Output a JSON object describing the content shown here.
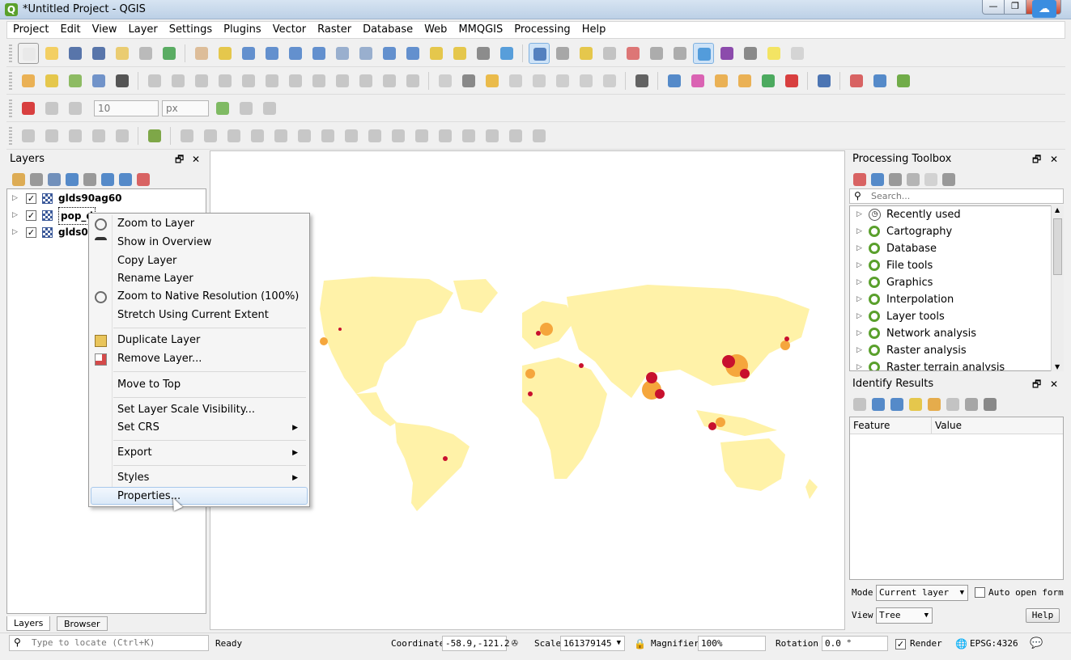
{
  "window": {
    "title": "*Untitled Project - QGIS",
    "app_icon": "qgis-logo-icon",
    "min": "—",
    "max": "❐",
    "close": "✕"
  },
  "menubar": [
    "Project",
    "Edit",
    "View",
    "Layer",
    "Settings",
    "Plugins",
    "Vector",
    "Raster",
    "Database",
    "Web",
    "MMQGIS",
    "Processing",
    "Help"
  ],
  "digitizing": {
    "snap_tolerance": "10",
    "snap_unit": "px"
  },
  "layers_panel": {
    "title": "Layers",
    "float_icon": "🗗",
    "close_icon": "✕",
    "layers": [
      {
        "name": "glds90ag60",
        "checked": "✓",
        "expand": "▷"
      },
      {
        "name": "pop_d",
        "checked": "✓",
        "expand": "▷"
      },
      {
        "name": "glds00",
        "checked": "✓",
        "expand": "▷"
      }
    ],
    "tabs": [
      "Layers",
      "Browser"
    ]
  },
  "context_menu": {
    "items": [
      {
        "label": "Zoom to Layer",
        "icon": "zoom-layer-icon"
      },
      {
        "label": "Show in Overview",
        "icon": "overview-icon"
      },
      {
        "label": "Copy Layer"
      },
      {
        "label": "Rename Layer"
      },
      {
        "label": "Zoom to Native Resolution (100%)",
        "icon": "native-resolution-icon"
      },
      {
        "label": "Stretch Using Current Extent"
      },
      {
        "label": "Duplicate Layer",
        "icon": "duplicate-icon"
      },
      {
        "label": "Remove Layer...",
        "icon": "remove-layer-icon"
      },
      {
        "label": "Move to Top"
      },
      {
        "label": "Set Layer Scale Visibility..."
      },
      {
        "label": "Set CRS",
        "submenu": "▶"
      },
      {
        "label": "Export",
        "submenu": "▶"
      },
      {
        "label": "Styles",
        "submenu": "▶"
      },
      {
        "label": "Properties..."
      }
    ]
  },
  "processing": {
    "title": "Processing Toolbox",
    "float_icon": "🗗",
    "close_icon": "✕",
    "search_placeholder": "Search...",
    "items": [
      "Recently used",
      "Cartography",
      "Database",
      "File tools",
      "Graphics",
      "Interpolation",
      "Layer tools",
      "Network analysis",
      "Raster analysis",
      "Raster terrain analysis"
    ]
  },
  "identify": {
    "title": "Identify Results",
    "float_icon": "🗗",
    "close_icon": "✕",
    "columns": [
      "Feature",
      "Value"
    ],
    "mode_label": "Mode",
    "mode_value": "Current layer",
    "auto_open_label": "Auto open form",
    "view_label": "View",
    "view_value": "Tree",
    "help_label": "Help"
  },
  "status": {
    "locator_placeholder": "Type to locate (Ctrl+K)",
    "ready": "Ready",
    "coordinate_label": "Coordinate",
    "coordinate_value": "-58.9,-121.2",
    "scale_label": "Scale",
    "scale_value": "161379145",
    "magnifier_label": "Magnifier",
    "magnifier_value": "100%",
    "rotation_label": "Rotation",
    "rotation_value": "0.0 °",
    "render_label": "Render",
    "render_checked": "✓",
    "crs": "EPSG:4326"
  },
  "colors": {
    "map_low": "#fff2a8",
    "map_mid": "#f5a63c",
    "map_high": "#c8102e",
    "qgis_green": "#5aa02c"
  }
}
